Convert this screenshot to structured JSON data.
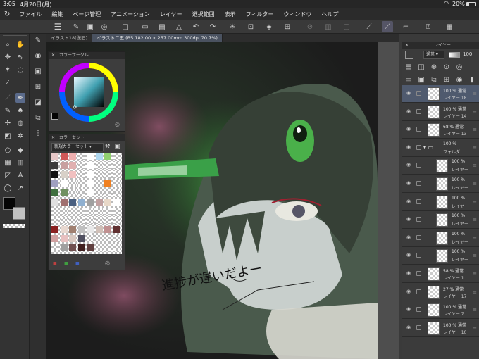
{
  "status": {
    "time": "3:05",
    "date": "4月20日(月)",
    "battery": "20%"
  },
  "menu": [
    "ファイル",
    "編集",
    "ページ管理",
    "アニメーション",
    "レイヤー",
    "選択範囲",
    "表示",
    "フィルター",
    "ウィンドウ",
    "ヘルプ"
  ],
  "tabs": [
    "イラスト18(復旧)",
    "イラスト二五 (B5 182.00 × 257.00mm 300dpi 70.7%)"
  ],
  "color_circle": {
    "title": "カラーサークル"
  },
  "color_set": {
    "title": "カラーセット",
    "dropdown": "新規カラーセット"
  },
  "swatches": [
    "#e8c8c8",
    "#d05858",
    "#f0b0b0",
    "#f0f0f0",
    "#ffffff",
    "#b0d8f0",
    "#90d070",
    "#f0f0f0",
    "#3a3a3a",
    "#c8a0a0",
    "#e0b0b0",
    "#f0f0f0",
    "#ffffff",
    "#f0f0f0",
    "#f0f0f0",
    "#f0f0f0",
    "#101010",
    "#d8d0c8",
    "#f0c0c0",
    "#f0f0f0",
    "#ffffff",
    "#f0f0f0",
    "#f0f0f0",
    "#f0f0f0",
    "#a0a0c0",
    "#ffffff",
    "#f0f0f0",
    "#f0f0f0",
    "#ffffff",
    "#f0f0f0",
    "#f08020",
    "#f0f0f0",
    "#407040",
    "#709060",
    "#f0f0f0",
    "#f0f0f0",
    "#ffffff",
    "#f0f0f0",
    "#f0f0f0",
    "#f0f0f0",
    "#e0e0e0",
    "#a07070",
    "#4a6080",
    "#90b0d0",
    "#a0a0a0",
    "#c0a0a0",
    "#e8d8c8",
    "#ffffff",
    "#f0f0f0",
    "#f0f0f0",
    "#f0f0f0",
    "#f0f0f0",
    "#f0f0f0",
    "#f0f0f0",
    "#f0f0f0",
    "#f0f0f0",
    "#f0f0f0",
    "#f0f0f0",
    "#f0f0f0",
    "#f0f0f0",
    "#f0f0f0",
    "#f0f0f0",
    "#f0f0f0",
    "#f0f0f0",
    "#8a2020",
    "#e8d8d0",
    "#a08070",
    "#c0c0c0",
    "#e8e8e8",
    "#d0c0b8",
    "#c09090",
    "#603030",
    "#d0a0a0",
    "#e8c0c0",
    "#d8c8c0",
    "#505060",
    "#f0f0f0",
    "#f0f0f0",
    "#f0f0f0",
    "#f0f0f0",
    "#f0f0f0",
    "#a0a0a0",
    "#705050",
    "#402020",
    "#604040",
    "#f0f0f0",
    "#f0f0f0",
    "#f0f0f0"
  ],
  "layer_panel": {
    "title": "レイヤー",
    "blend": "通常",
    "opacity": "100"
  },
  "layers": [
    {
      "pct": "100 % 通常",
      "name": "レイヤー 18",
      "active": true
    },
    {
      "pct": "100 % 通常",
      "name": "レイヤー 14"
    },
    {
      "pct": "68 % 通常",
      "name": "レイヤー 13"
    },
    {
      "pct": "100 %",
      "name": "フォルダ",
      "folder": true
    },
    {
      "pct": "100 %",
      "name": "レイヤー"
    },
    {
      "pct": "100 %",
      "name": "レイヤー"
    },
    {
      "pct": "100 %",
      "name": "レイヤー"
    },
    {
      "pct": "100 %",
      "name": "レイヤー"
    },
    {
      "pct": "100 %",
      "name": "レイヤー"
    },
    {
      "pct": "100 %",
      "name": "レイヤー"
    },
    {
      "pct": "58 % 通常",
      "name": "レイヤー 1"
    },
    {
      "pct": "27 % 通常",
      "name": "レイヤー 17"
    },
    {
      "pct": "100 % 通常",
      "name": "レイヤー 7"
    },
    {
      "pct": "100 % 通常",
      "name": "レイヤー 10"
    }
  ],
  "canvas_text": "進捗が遅いだよー",
  "colors": {
    "main": "#050505",
    "sub": "#c0c0c0",
    "accent": "#4a90d9"
  }
}
